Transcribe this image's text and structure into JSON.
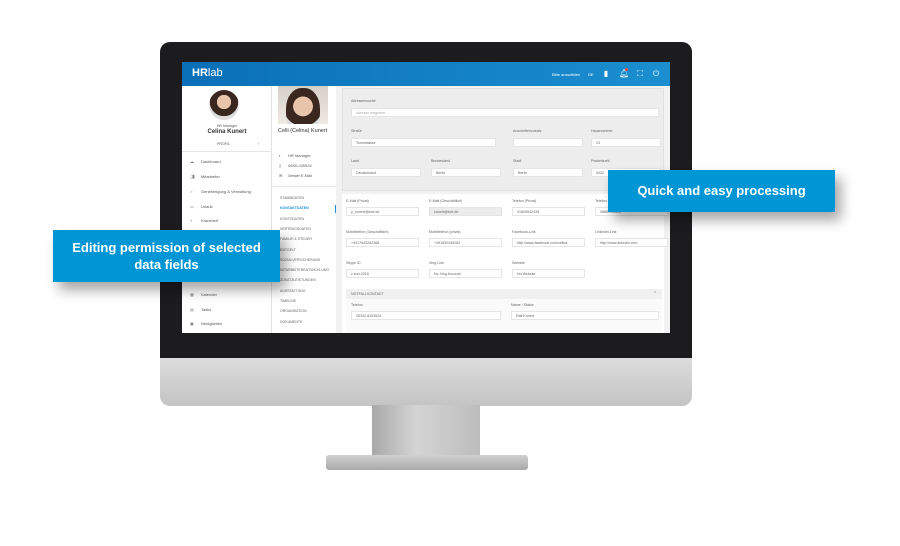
{
  "callouts": {
    "right": "Quick and easy processing",
    "left": "Editing permission of selected data fields"
  },
  "topbar": {
    "logo_bold": "HR",
    "logo_light": "lab",
    "select": "Bitte auswählen",
    "lang": "DE",
    "icons": [
      "info-icon",
      "bell-icon",
      "fullscreen-icon",
      "power-icon"
    ],
    "accent": "#0a6fb8"
  },
  "sidebar": {
    "role": "HR Manager",
    "name": "Celina Kunert",
    "profile": "PROFIL",
    "items": [
      {
        "label": "Dashboard",
        "icon": "cloud"
      },
      {
        "label": "Mitarbeiter",
        "icon": "people"
      },
      {
        "label": "Genehmigung & Verwaltung",
        "icon": "check"
      },
      {
        "label": "Urlaub",
        "icon": "suitcase"
      },
      {
        "label": "Krankheit",
        "icon": "stethoscope"
      },
      {
        "label": "Kalender",
        "icon": "calendar"
      },
      {
        "label": "Tasks",
        "icon": "clipboard"
      },
      {
        "label": "Neuigkeiten",
        "icon": "news"
      }
    ]
  },
  "profile": {
    "name": "Celli (Celina) Kunert",
    "position": "HR Manager",
    "phone": "0665-245524",
    "email": "Sende E-Mail",
    "sections": [
      "Stammdaten",
      "Kontaktdaten",
      "Kontodaten",
      "Vertragsdaten",
      "Familie & Steuer",
      "Entgelt",
      "Sozialversicherung",
      "Mitarbeiterentwicklung",
      "Zusatzleistungen",
      "Ausstattung",
      "Timeline",
      "Organisation",
      "Dokumente"
    ],
    "active": "Kontaktdaten"
  },
  "address": {
    "search_label": "Adressensuche",
    "search_placeholder": "Adresse eingeben...",
    "fields": [
      {
        "label": "Straße",
        "value": "Tormstrasse"
      },
      {
        "label": "Anschriftenzusatz",
        "value": ""
      },
      {
        "label": "Hausnummer",
        "value": "23"
      },
      {
        "label": "Land",
        "value": "Deutschland"
      },
      {
        "label": "Bundesland",
        "value": "Berlin"
      },
      {
        "label": "Stadt",
        "value": "Berlin"
      },
      {
        "label": "Postleitzahl",
        "value": "5432"
      }
    ]
  },
  "contact": {
    "fields": [
      {
        "label": "E-Mail (Privat)",
        "value": "p_kunert@inet.de"
      },
      {
        "label": "E-Mail (Geschäftlich)",
        "value": "kunert@inet.de"
      },
      {
        "label": "Telefon (Privat)",
        "value": "01605542439"
      },
      {
        "label": "Telefon (Geschäftlich)",
        "value": "0665-245524"
      },
      {
        "label": "Mobiltelefon (Geschäftlich)",
        "value": "+4917643282368"
      },
      {
        "label": "Mobiltelefon (privat)",
        "value": "+491652435263"
      },
      {
        "label": "Facebook-Link",
        "value": "http://www.facebook.com/celina"
      },
      {
        "label": "LinkedIn-Link",
        "value": "http://www.linkedin.com"
      },
      {
        "label": "Skype ID",
        "value": "c.kun-2018"
      },
      {
        "label": "Xing Link",
        "value": "No Xing Account"
      },
      {
        "label": "Website",
        "value": "No Website"
      }
    ]
  },
  "emergency": {
    "title": "NOTFALLKONTAKT",
    "phone_label": "Telefon",
    "phone": "05342-6253524",
    "name_label": "Name / Status",
    "name": "Ralf Kunert"
  }
}
